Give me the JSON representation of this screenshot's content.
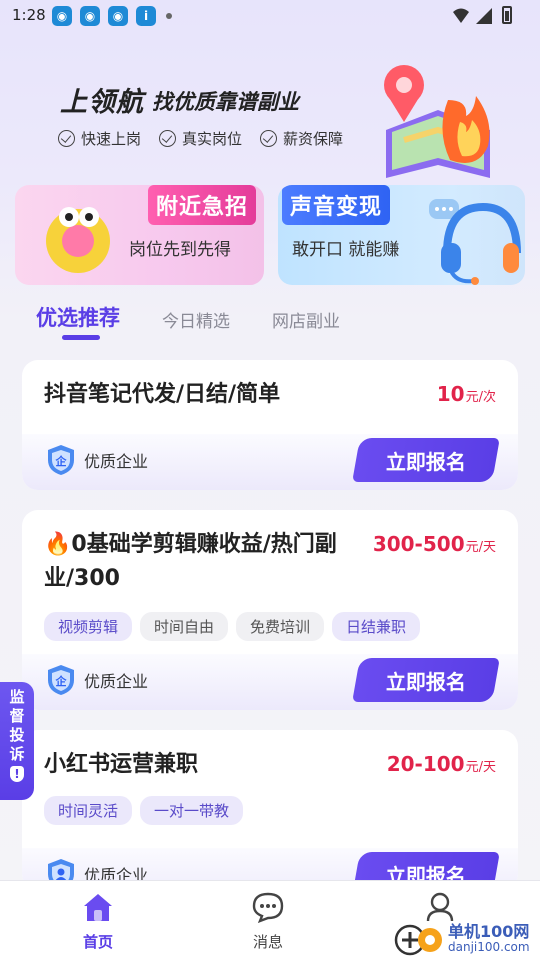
{
  "status_bar": {
    "time": "1:28",
    "app_icons": [
      "app-icon",
      "app-icon",
      "app-icon",
      "info-app-icon"
    ]
  },
  "hero": {
    "title": "上领航",
    "subtitle": "找优质靠谱副业",
    "features": [
      "快速上岗",
      "真实岗位",
      "薪资保障"
    ]
  },
  "promos": [
    {
      "badge": "附近急招",
      "text": "岗位先到先得"
    },
    {
      "badge": "声音变现",
      "text": "敢开口  就能赚"
    }
  ],
  "tabs": [
    {
      "label": "优选推荐",
      "active": true
    },
    {
      "label": "今日精选",
      "active": false
    },
    {
      "label": "网店副业",
      "active": false
    }
  ],
  "jobs": [
    {
      "title": "抖音笔记代发/日结/简单",
      "price": "10",
      "unit": "元/次",
      "tags": [],
      "enterprise": "优质企业",
      "apply": "立即报名"
    },
    {
      "title_line1": "🔥0基础学剪辑赚收益/热门副",
      "title_line2": "业/300",
      "price": "300-500",
      "unit": "元/天",
      "tags": [
        "视频剪辑",
        "时间自由",
        "免费培训",
        "日结兼职"
      ],
      "enterprise": "优质企业",
      "apply": "立即报名"
    },
    {
      "title": "小红书运营兼职",
      "price": "20-100",
      "unit": "元/天",
      "tags": [
        "时间灵活",
        "一对一带教"
      ],
      "enterprise": "优质企业",
      "apply": "立即报名"
    }
  ],
  "complaint": {
    "chars": [
      "监",
      "督",
      "投",
      "诉"
    ],
    "icon": "!"
  },
  "bottom_nav": [
    {
      "label": "首页",
      "icon": "home-icon",
      "active": true
    },
    {
      "label": "消息",
      "icon": "message-icon",
      "active": false
    },
    {
      "label": "",
      "icon": "profile-icon",
      "active": false
    }
  ],
  "watermark": {
    "cn": "单机100网",
    "en": "danji100.com"
  },
  "colors": {
    "accent": "#5a3ee6",
    "price": "#e1234a",
    "pink_badge": "#e43b9a",
    "blue_badge": "#2f63f3"
  }
}
